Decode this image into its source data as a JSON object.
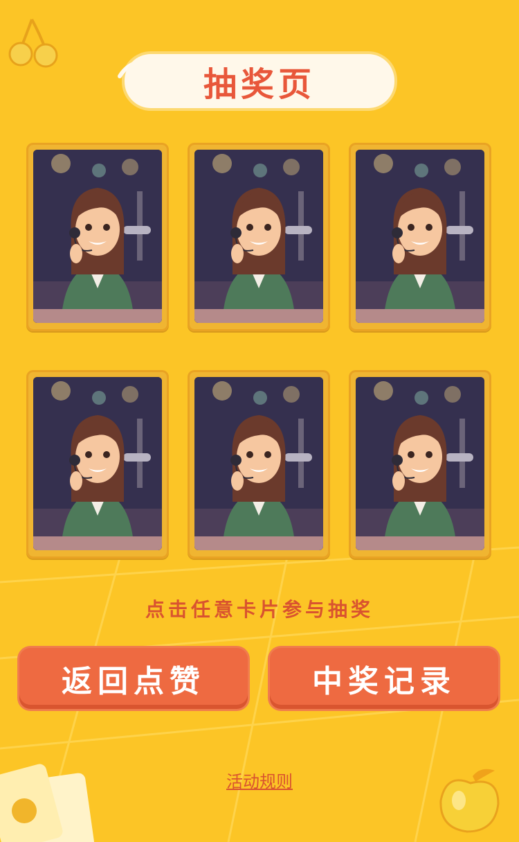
{
  "page": {
    "title": "抽奖页",
    "hint": "点击任意卡片参与抽奖",
    "back_button": "返回点赞",
    "records_button": "中奖记录",
    "rules_link": "活动规则"
  },
  "cards": [
    {
      "image": "operator-woman-headset"
    },
    {
      "image": "operator-woman-headset"
    },
    {
      "image": "operator-woman-headset"
    },
    {
      "image": "operator-woman-headset"
    },
    {
      "image": "operator-woman-headset"
    },
    {
      "image": "operator-woman-headset"
    }
  ],
  "colors": {
    "background": "#fcc526",
    "accent": "#ee6a41",
    "title_text": "#e8573a",
    "card_frame": "#f0b531"
  }
}
